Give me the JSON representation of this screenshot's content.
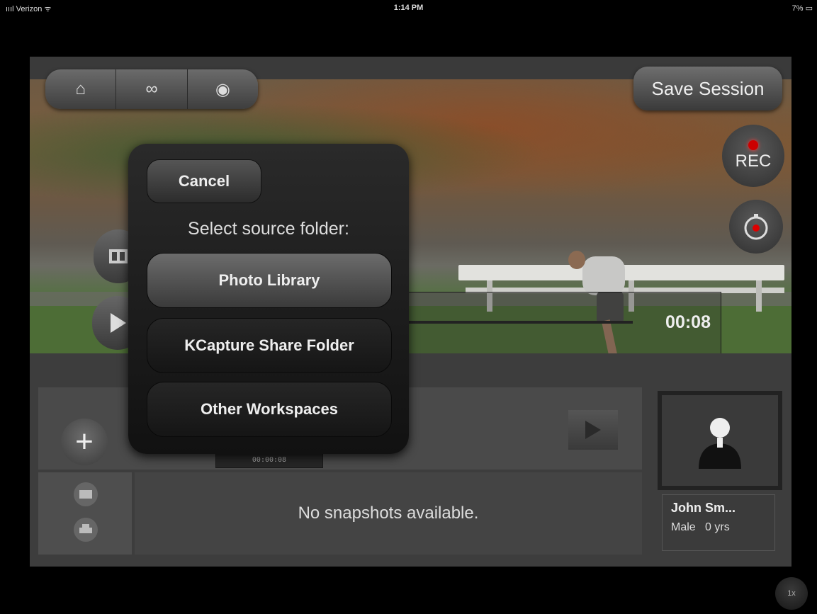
{
  "status_bar": {
    "carrier": "ıııl Verizon ᯤ",
    "time": "1:14 PM",
    "battery": "7% ▭"
  },
  "top_bar": {
    "buttons": [
      {
        "icon": "home-icon",
        "glyph": "⌂"
      },
      {
        "icon": "link-icon",
        "glyph": "∞"
      },
      {
        "icon": "eye-icon",
        "glyph": "◉"
      }
    ],
    "save_label": "Save Session"
  },
  "record": {
    "label": "REC"
  },
  "player": {
    "current_time": "00:08"
  },
  "popup": {
    "cancel_label": "Cancel",
    "prompt": "Select source folder:",
    "options": [
      "Photo Library",
      "KCapture Share Folder",
      "Other Workspaces"
    ]
  },
  "timeline": {
    "timecode": "00:00:08"
  },
  "snapshots": {
    "empty_text": "No snapshots available."
  },
  "profile": {
    "name": "John Sm...",
    "gender": "Male",
    "age": "0 yrs"
  },
  "speed": {
    "label": "1x"
  }
}
